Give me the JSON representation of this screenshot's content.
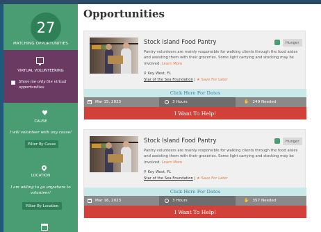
{
  "sidebar": {
    "count": "27",
    "count_label": "MATCHING OPPORTUNITIES",
    "virtual": {
      "title": "VIRTUAL VOLUNTEERING",
      "checkbox_label": "Show me only the virtual opportunities"
    },
    "cause": {
      "title": "CAUSE",
      "text": "I will volunteer with any cause!",
      "button": "Filter By Cause"
    },
    "location": {
      "title": "LOCATION",
      "text": "I am willing to go anywhere to volunteer!",
      "button": "Filter By Location"
    }
  },
  "main": {
    "title": "Opportunities",
    "cards": [
      {
        "title": "Stock Island Food Pantry",
        "tag": "Hunger",
        "description": "Pantry volunteers are mainly responsible for walking clients through the food aisles and assisting them with their groceries. Some light carrying and stocking may be involved.",
        "learn_more": "Learn More",
        "location": "Key West, FL",
        "organization": "Star of the Sea Foundation",
        "separator": "|",
        "save_later": "Save For Later",
        "dates_link": "Click Here For Dates",
        "date": "Mar 15, 2023",
        "hours": "3 Hours",
        "needed": "249 Needed",
        "help_button": "I Want To Help!"
      },
      {
        "title": "Stock Island Food Pantry",
        "tag": "Hunger",
        "description": "Pantry volunteers are mainly responsible for walking clients through the food aisles and assisting them with their groceries. Some light carrying and stocking may be involved.",
        "learn_more": "Learn More",
        "location": "Key West, FL",
        "organization": "Star of the Sea Foundation",
        "separator": "|",
        "save_later": "Save For Later",
        "dates_link": "Click Here For Dates",
        "date": "Mar 16, 2023",
        "hours": "3 Hours",
        "needed": "357 Needed",
        "help_button": "I Want To Help!"
      }
    ]
  },
  "icons": {
    "virtual": "monitor-icon",
    "cause": "heart-icon",
    "location": "map-pin-icon",
    "date": "calendar-icon",
    "tag": "hunger-icon",
    "hours": "clock-icon",
    "needed": "hand-icon",
    "star": "star-icon"
  },
  "colors": {
    "sidebar": "#4a9d72",
    "virtual_block": "#6b3a63",
    "accent_orange": "#e8793b",
    "help_red": "#d1413a",
    "dates_bar": "#c9e8e8"
  }
}
